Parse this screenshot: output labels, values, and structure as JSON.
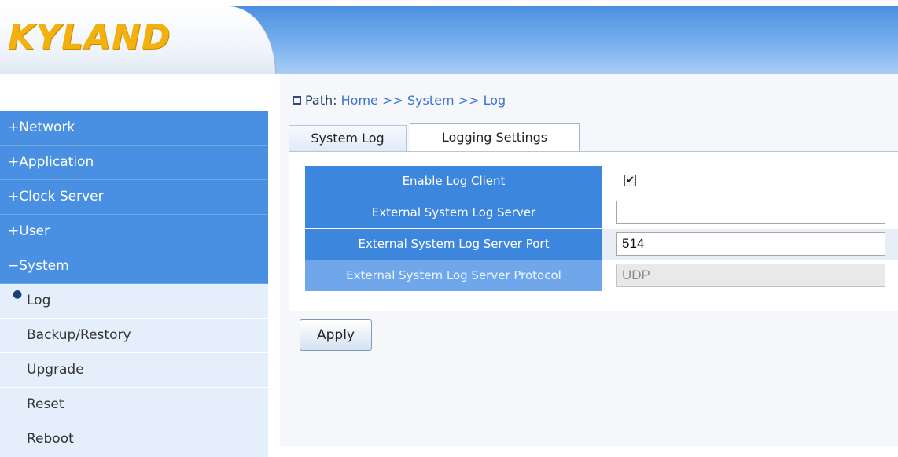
{
  "brand": {
    "logo_text": "KYLAND"
  },
  "sidebar": {
    "items": [
      {
        "label": "+Network",
        "type": "top"
      },
      {
        "label": "+Application",
        "type": "top"
      },
      {
        "label": "+Clock Server",
        "type": "top"
      },
      {
        "label": "+User",
        "type": "top"
      },
      {
        "label": "−System",
        "type": "top"
      },
      {
        "label": "Log",
        "type": "sub",
        "active": true
      },
      {
        "label": "Backup/Restory",
        "type": "sub"
      },
      {
        "label": "Upgrade",
        "type": "sub"
      },
      {
        "label": "Reset",
        "type": "sub"
      },
      {
        "label": "Reboot",
        "type": "sub"
      }
    ]
  },
  "breadcrumb": {
    "prefix": "Path:",
    "home": "Home",
    "separator": ">>",
    "section": "System",
    "page": "Log"
  },
  "tabs": [
    {
      "label": "System Log",
      "active": false
    },
    {
      "label": "Logging Settings",
      "active": true
    }
  ],
  "settings": {
    "enable_log_client": {
      "label": "Enable Log Client",
      "checked": true,
      "check_glyph": "✔"
    },
    "server": {
      "label": "External System Log Server",
      "value": ""
    },
    "port": {
      "label": "External System Log Server Port",
      "value": "514"
    },
    "protocol": {
      "label": "External System Log Server Protocol",
      "value": "UDP",
      "disabled": true
    }
  },
  "actions": {
    "apply_label": "Apply"
  },
  "colors": {
    "header_blue": "#4d8fe0",
    "menu_blue": "#4a90e2",
    "label_blue": "#3c86dd",
    "logo_gold": "#f3b10f"
  },
  "icons": {
    "path_icon": "square-icon",
    "active_bullet": "bullet-icon",
    "checkbox": "checkmark-icon"
  }
}
